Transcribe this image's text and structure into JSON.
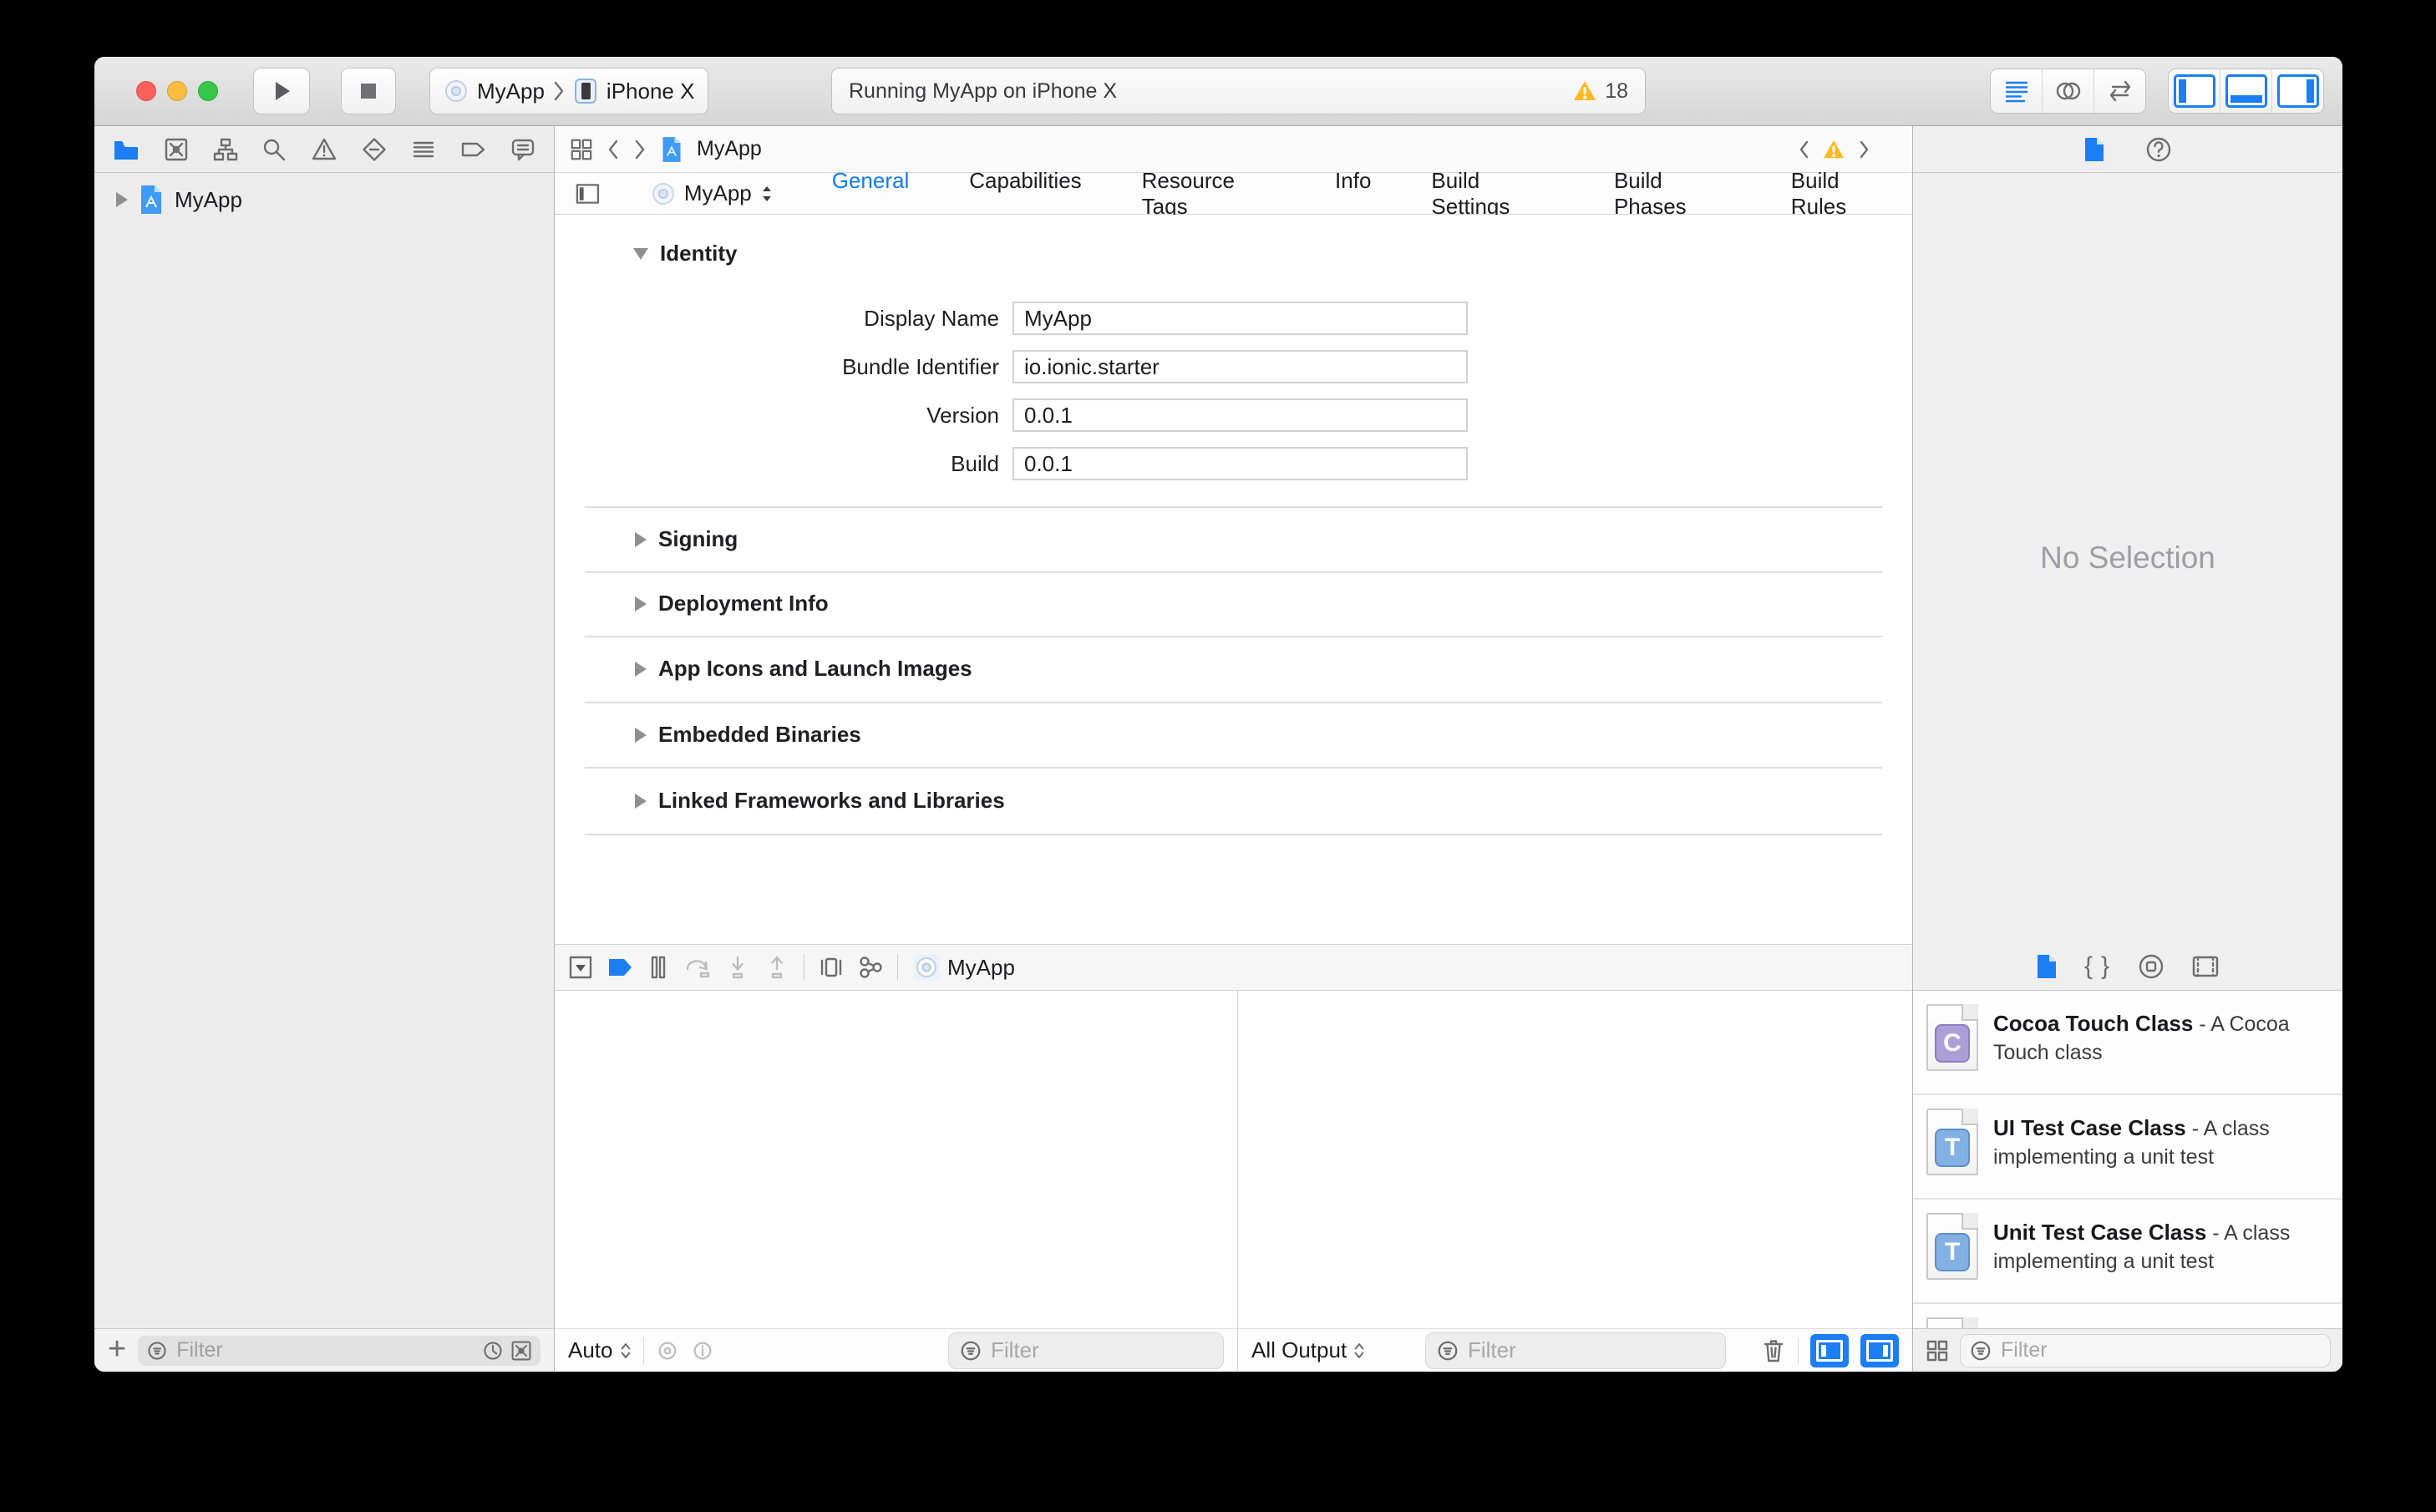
{
  "window": {
    "toolbar": {
      "scheme_target": "MyApp",
      "scheme_device": "iPhone X",
      "status_message": "Running MyApp on iPhone X",
      "warning_count": "18"
    },
    "navigator": {
      "project_name": "MyApp",
      "filter_placeholder": "Filter"
    },
    "jump_bar": {
      "file_name": "MyApp"
    },
    "editor": {
      "target_name": "MyApp",
      "tabs": [
        {
          "label": "General"
        },
        {
          "label": "Capabilities"
        },
        {
          "label": "Resource Tags"
        },
        {
          "label": "Info"
        },
        {
          "label": "Build Settings"
        },
        {
          "label": "Build Phases"
        },
        {
          "label": "Build Rules"
        }
      ],
      "identity": {
        "title": "Identity",
        "fields": [
          {
            "label": "Display Name",
            "value": "MyApp"
          },
          {
            "label": "Bundle Identifier",
            "value": "io.ionic.starter"
          },
          {
            "label": "Version",
            "value": "0.0.1"
          },
          {
            "label": "Build",
            "value": "0.0.1"
          }
        ]
      },
      "collapsed_sections": [
        {
          "title": "Signing"
        },
        {
          "title": "Deployment Info"
        },
        {
          "title": "App Icons and Launch Images"
        },
        {
          "title": "Embedded Binaries"
        },
        {
          "title": "Linked Frameworks and Libraries"
        }
      ]
    },
    "debug": {
      "target_name": "MyApp",
      "variables_scope": "Auto",
      "variables_filter_placeholder": "Filter",
      "console_scope": "All Output",
      "console_filter_placeholder": "Filter"
    },
    "inspector": {
      "empty_message": "No Selection"
    },
    "library": {
      "items": [
        {
          "badge": "C",
          "title": "Cocoa Touch Class",
          "desc": "- A Cocoa Touch class"
        },
        {
          "badge": "T",
          "title": "UI Test Case Class",
          "desc": "- A class implementing a unit test"
        },
        {
          "badge": "T",
          "title": "Unit Test Case Class",
          "desc": "- A class implementing a unit test"
        }
      ],
      "filter_placeholder": "Filter"
    },
    "colors": {
      "accent": "#1b7ef2",
      "warning": "#fdb924"
    }
  }
}
